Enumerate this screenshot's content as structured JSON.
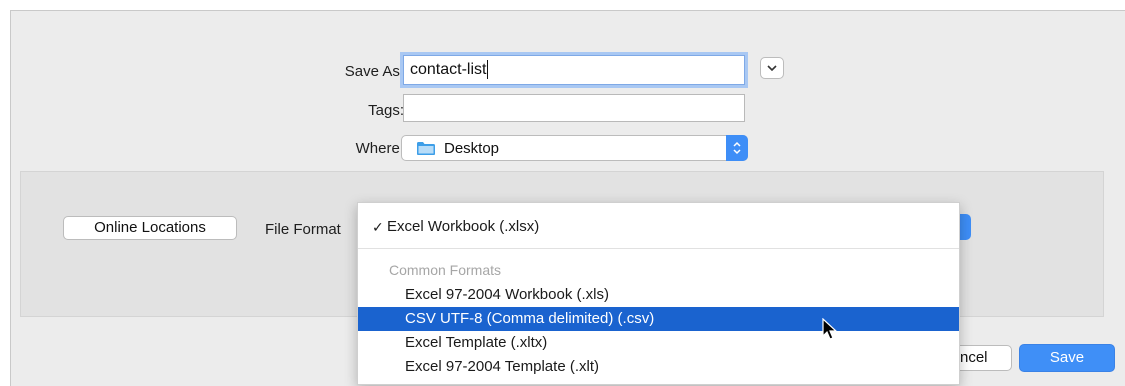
{
  "save_as": {
    "label": "Save As:",
    "value": "contact-list"
  },
  "tags": {
    "label": "Tags:",
    "value": ""
  },
  "where": {
    "label": "Where:",
    "value": "Desktop"
  },
  "accessory": {
    "online_locations_label": "Online Locations",
    "file_format_label": "File Format"
  },
  "format_menu": {
    "selected": "Excel Workbook (.xlsx)",
    "section_header": "Common Formats",
    "options": [
      {
        "label": "Excel 97-2004 Workbook (.xls)"
      },
      {
        "label": "CSV UTF-8 (Comma delimited) (.csv)"
      },
      {
        "label": "Excel Template (.xltx)"
      },
      {
        "label": "Excel 97-2004 Template (.xlt)"
      }
    ],
    "highlighted_index": 1
  },
  "footer": {
    "cancel_label_visible": "ncel",
    "save_label": "Save"
  },
  "colors": {
    "accent": "#3f8ff7",
    "menu_highlight": "#1a63cf",
    "dialog_bg": "#ececec"
  }
}
